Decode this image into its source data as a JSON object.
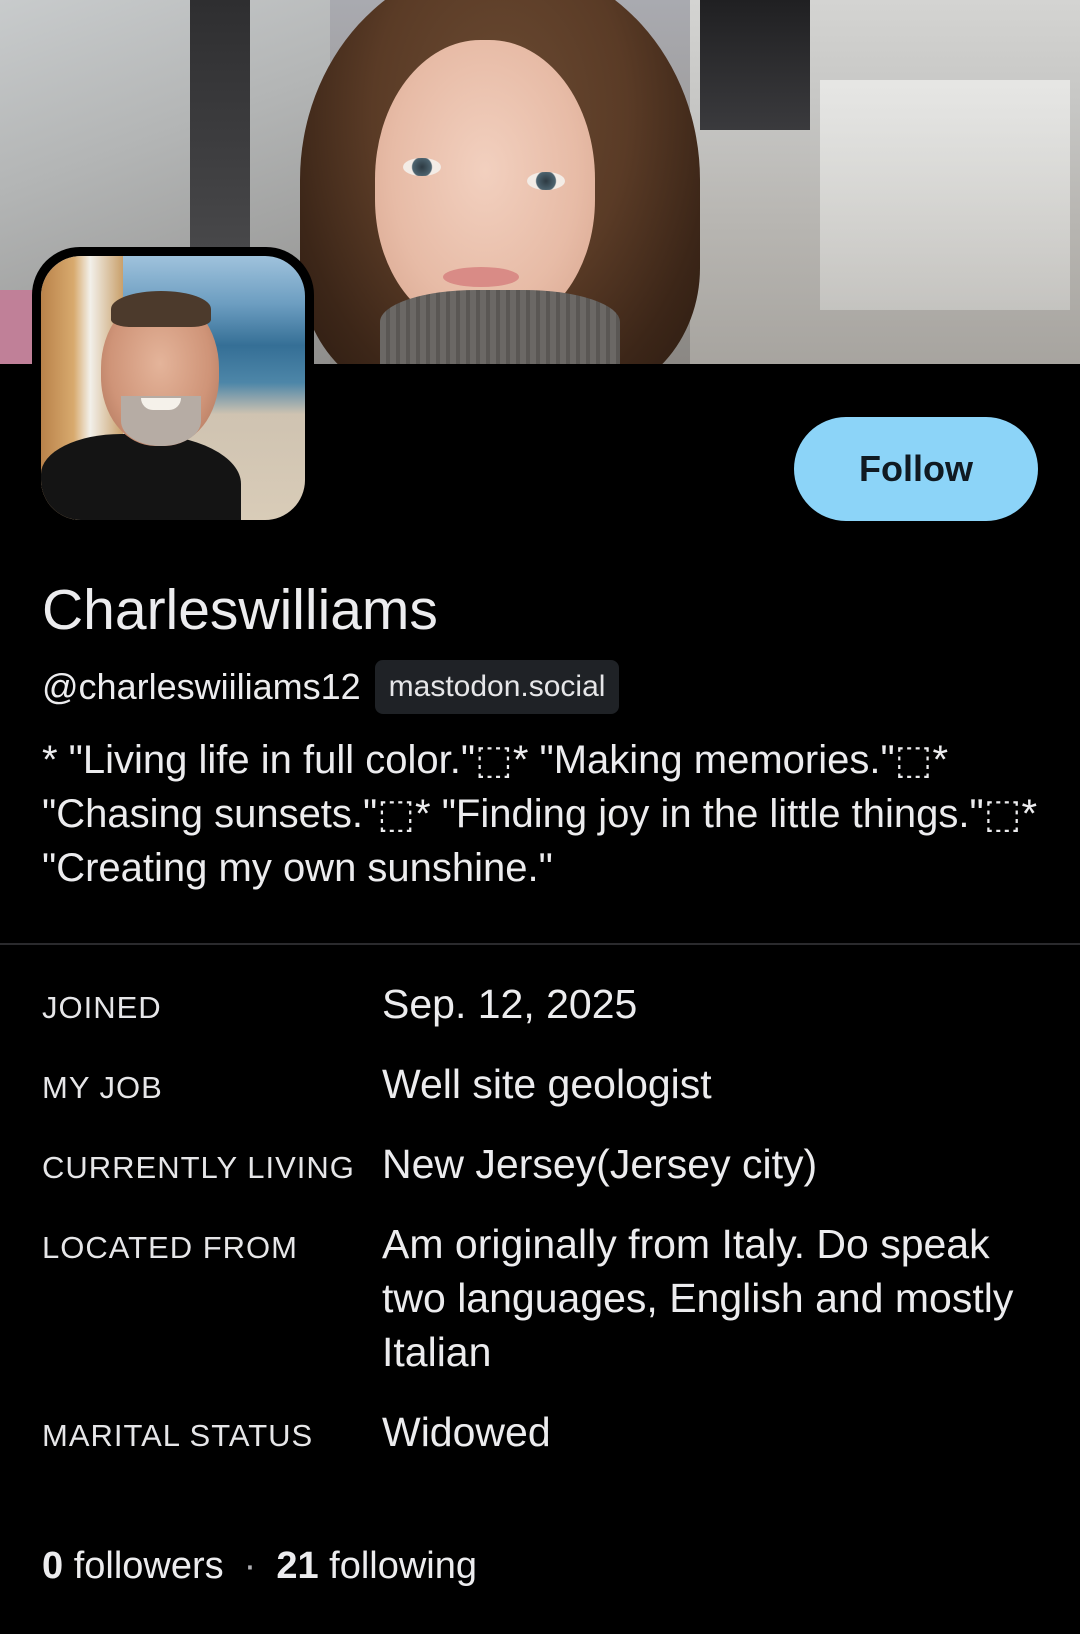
{
  "profile": {
    "display_name": "Charleswilliams",
    "handle": "@charleswiiliams12",
    "server": "mastodon.social",
    "bio": "* \"Living life in full color.\"⬚* \"Making memories.\"⬚* \"Chasing sunsets.\"⬚* \"Finding joy in the little things.\"⬚* \"Creating my own sunshine.\"",
    "follow_label": "Follow"
  },
  "fields": [
    {
      "label": "JOINED",
      "value": "Sep. 12, 2025"
    },
    {
      "label": "MY JOB",
      "value": "Well site geologist"
    },
    {
      "label": "CURRENTLY LIVING",
      "value": "New Jersey(Jersey city)"
    },
    {
      "label": "LOCATED FROM",
      "value": "Am originally from Italy. Do speak two languages, English and mostly Italian"
    },
    {
      "label": "MARITAL STATUS",
      "value": "Widowed"
    }
  ],
  "stats": {
    "followers_count": "0",
    "followers_label": "followers",
    "separator": "·",
    "following_count": "21",
    "following_label": "following"
  },
  "colors": {
    "background": "#000000",
    "accent": "#8cd4f8",
    "badge_bg": "#1f2226"
  }
}
